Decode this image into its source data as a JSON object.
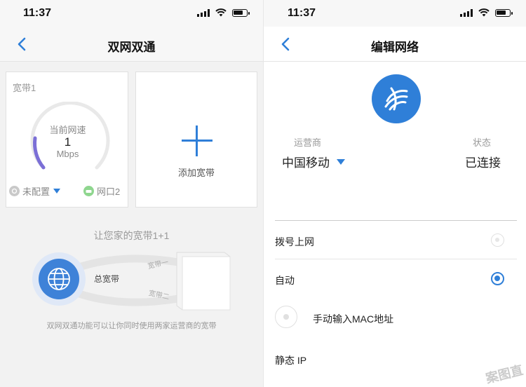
{
  "left": {
    "status": {
      "time": "11:37"
    },
    "nav": {
      "title": "双网双通"
    },
    "card1": {
      "label": "宽带1",
      "speed_label": "当前网速",
      "speed_value": "1",
      "speed_unit": "Mbps",
      "config_status": "未配置",
      "port": "网口2"
    },
    "card2": {
      "label": "添加宽带"
    },
    "illustration": {
      "title": "让您家的宽带1+1",
      "center_label": "总宽带",
      "line1": "宽带一",
      "line2": "宽带二",
      "caption": "双网双通功能可以让你同时使用两家运营商的宽带"
    }
  },
  "right": {
    "status": {
      "time": "11:37"
    },
    "nav": {
      "title": "编辑网络"
    },
    "operator_label": "运营商",
    "operator_value": "中国移动",
    "status_label": "状态",
    "status_value": "已连接",
    "options": [
      {
        "label": "拨号上网",
        "selected": false
      },
      {
        "label": "自动",
        "selected": true
      },
      {
        "label": "手动输入MAC地址",
        "selected": false
      },
      {
        "label": "静态 IP",
        "selected": false
      }
    ],
    "watermark": "案图直"
  },
  "colors": {
    "accent": "#2f7fd8",
    "gauge_arc": "#7b6fd6"
  },
  "icons": [
    "chevron-left-icon",
    "signal-icon",
    "wifi-icon",
    "battery-icon",
    "globe-icon",
    "plus-icon",
    "router-icon",
    "china-mobile-logo"
  ]
}
